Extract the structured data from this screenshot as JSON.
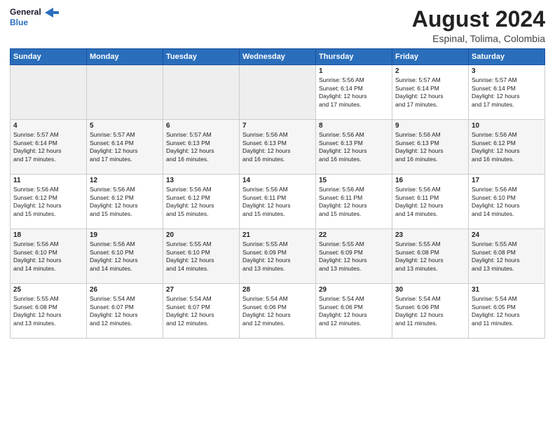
{
  "header": {
    "logo_line1": "General",
    "logo_line2": "Blue",
    "month": "August 2024",
    "location": "Espinal, Tolima, Colombia"
  },
  "days_of_week": [
    "Sunday",
    "Monday",
    "Tuesday",
    "Wednesday",
    "Thursday",
    "Friday",
    "Saturday"
  ],
  "weeks": [
    [
      {
        "day": "",
        "info": ""
      },
      {
        "day": "",
        "info": ""
      },
      {
        "day": "",
        "info": ""
      },
      {
        "day": "",
        "info": ""
      },
      {
        "day": "1",
        "info": "Sunrise: 5:56 AM\nSunset: 6:14 PM\nDaylight: 12 hours\nand 17 minutes."
      },
      {
        "day": "2",
        "info": "Sunrise: 5:57 AM\nSunset: 6:14 PM\nDaylight: 12 hours\nand 17 minutes."
      },
      {
        "day": "3",
        "info": "Sunrise: 5:57 AM\nSunset: 6:14 PM\nDaylight: 12 hours\nand 17 minutes."
      }
    ],
    [
      {
        "day": "4",
        "info": "Sunrise: 5:57 AM\nSunset: 6:14 PM\nDaylight: 12 hours\nand 17 minutes."
      },
      {
        "day": "5",
        "info": "Sunrise: 5:57 AM\nSunset: 6:14 PM\nDaylight: 12 hours\nand 17 minutes."
      },
      {
        "day": "6",
        "info": "Sunrise: 5:57 AM\nSunset: 6:13 PM\nDaylight: 12 hours\nand 16 minutes."
      },
      {
        "day": "7",
        "info": "Sunrise: 5:56 AM\nSunset: 6:13 PM\nDaylight: 12 hours\nand 16 minutes."
      },
      {
        "day": "8",
        "info": "Sunrise: 5:56 AM\nSunset: 6:13 PM\nDaylight: 12 hours\nand 16 minutes."
      },
      {
        "day": "9",
        "info": "Sunrise: 5:56 AM\nSunset: 6:13 PM\nDaylight: 12 hours\nand 16 minutes."
      },
      {
        "day": "10",
        "info": "Sunrise: 5:56 AM\nSunset: 6:12 PM\nDaylight: 12 hours\nand 16 minutes."
      }
    ],
    [
      {
        "day": "11",
        "info": "Sunrise: 5:56 AM\nSunset: 6:12 PM\nDaylight: 12 hours\nand 15 minutes."
      },
      {
        "day": "12",
        "info": "Sunrise: 5:56 AM\nSunset: 6:12 PM\nDaylight: 12 hours\nand 15 minutes."
      },
      {
        "day": "13",
        "info": "Sunrise: 5:56 AM\nSunset: 6:12 PM\nDaylight: 12 hours\nand 15 minutes."
      },
      {
        "day": "14",
        "info": "Sunrise: 5:56 AM\nSunset: 6:11 PM\nDaylight: 12 hours\nand 15 minutes."
      },
      {
        "day": "15",
        "info": "Sunrise: 5:56 AM\nSunset: 6:11 PM\nDaylight: 12 hours\nand 15 minutes."
      },
      {
        "day": "16",
        "info": "Sunrise: 5:56 AM\nSunset: 6:11 PM\nDaylight: 12 hours\nand 14 minutes."
      },
      {
        "day": "17",
        "info": "Sunrise: 5:56 AM\nSunset: 6:10 PM\nDaylight: 12 hours\nand 14 minutes."
      }
    ],
    [
      {
        "day": "18",
        "info": "Sunrise: 5:56 AM\nSunset: 6:10 PM\nDaylight: 12 hours\nand 14 minutes."
      },
      {
        "day": "19",
        "info": "Sunrise: 5:56 AM\nSunset: 6:10 PM\nDaylight: 12 hours\nand 14 minutes."
      },
      {
        "day": "20",
        "info": "Sunrise: 5:55 AM\nSunset: 6:10 PM\nDaylight: 12 hours\nand 14 minutes."
      },
      {
        "day": "21",
        "info": "Sunrise: 5:55 AM\nSunset: 6:09 PM\nDaylight: 12 hours\nand 13 minutes."
      },
      {
        "day": "22",
        "info": "Sunrise: 5:55 AM\nSunset: 6:09 PM\nDaylight: 12 hours\nand 13 minutes."
      },
      {
        "day": "23",
        "info": "Sunrise: 5:55 AM\nSunset: 6:08 PM\nDaylight: 12 hours\nand 13 minutes."
      },
      {
        "day": "24",
        "info": "Sunrise: 5:55 AM\nSunset: 6:08 PM\nDaylight: 12 hours\nand 13 minutes."
      }
    ],
    [
      {
        "day": "25",
        "info": "Sunrise: 5:55 AM\nSunset: 6:08 PM\nDaylight: 12 hours\nand 13 minutes."
      },
      {
        "day": "26",
        "info": "Sunrise: 5:54 AM\nSunset: 6:07 PM\nDaylight: 12 hours\nand 12 minutes."
      },
      {
        "day": "27",
        "info": "Sunrise: 5:54 AM\nSunset: 6:07 PM\nDaylight: 12 hours\nand 12 minutes."
      },
      {
        "day": "28",
        "info": "Sunrise: 5:54 AM\nSunset: 6:06 PM\nDaylight: 12 hours\nand 12 minutes."
      },
      {
        "day": "29",
        "info": "Sunrise: 5:54 AM\nSunset: 6:06 PM\nDaylight: 12 hours\nand 12 minutes."
      },
      {
        "day": "30",
        "info": "Sunrise: 5:54 AM\nSunset: 6:06 PM\nDaylight: 12 hours\nand 11 minutes."
      },
      {
        "day": "31",
        "info": "Sunrise: 5:54 AM\nSunset: 6:05 PM\nDaylight: 12 hours\nand 11 minutes."
      }
    ]
  ]
}
